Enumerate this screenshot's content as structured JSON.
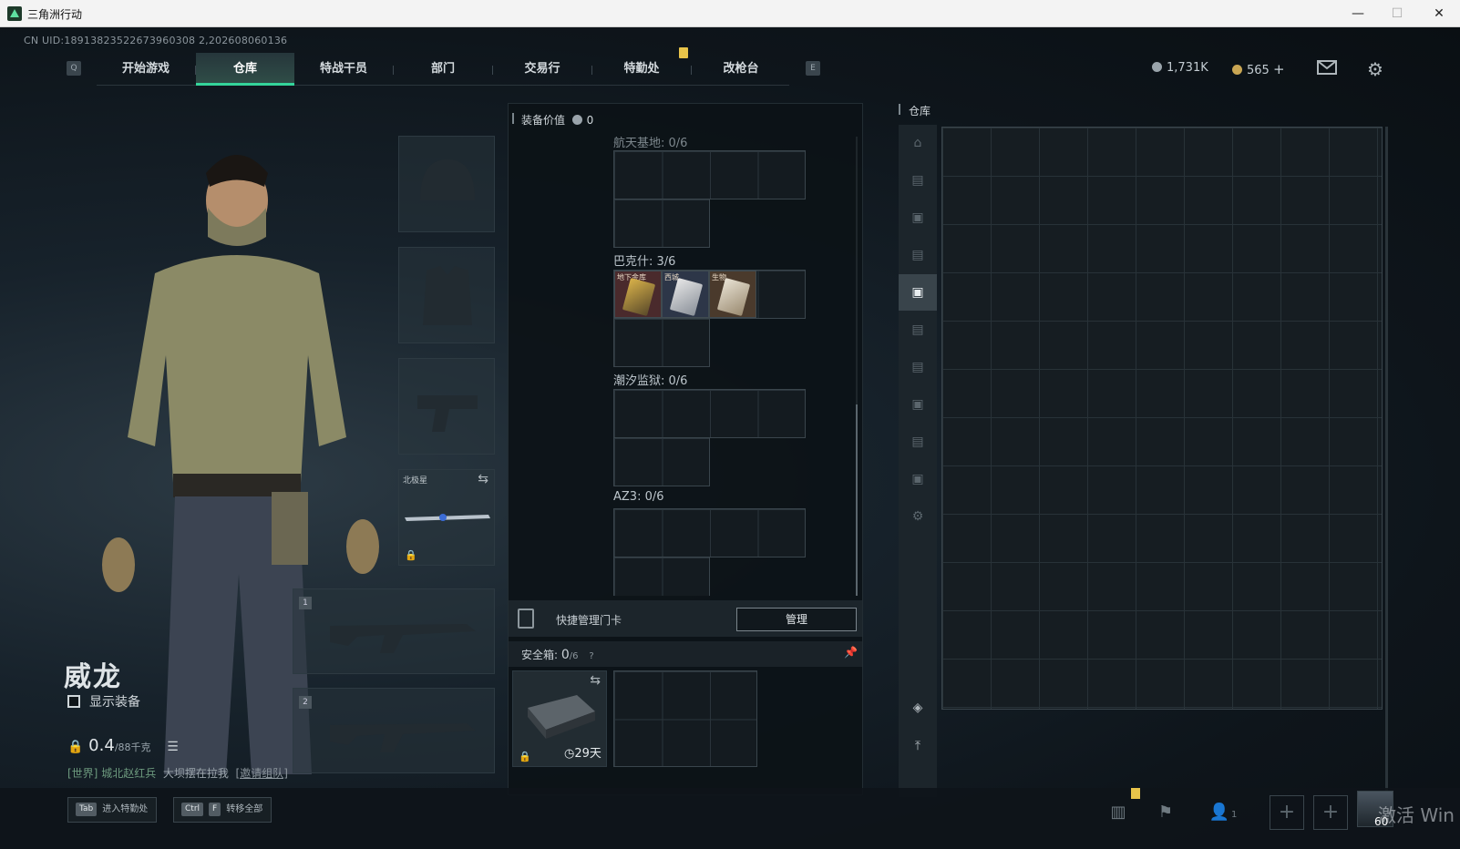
{
  "window": {
    "title": "三角洲行动",
    "minimize": "—",
    "maximize": "☐",
    "close": "✕"
  },
  "uid": "CN UID:18913823522673960308 2,202608060136",
  "nav": {
    "left_key": "Q",
    "right_key": "E",
    "tabs": [
      "开始游戏",
      "仓库",
      "特战干员",
      "部门",
      "交易行",
      "特勤处",
      "改枪台"
    ],
    "active_tab": "仓库"
  },
  "currency": {
    "silver": "1,731K",
    "gold": "565",
    "plus": "+"
  },
  "character": {
    "name": "威龙",
    "show_equipment": "显示装备",
    "weight_value": "0.4",
    "weight_unit": "/88千克"
  },
  "chat": {
    "channel": "[世界]",
    "user": "城北赵红兵",
    "message": "大坝摆在拉我",
    "invite": "[邀请组队]"
  },
  "equipment": {
    "melee_name": "北极星",
    "weapon1_num": "1",
    "weapon2_num": "2"
  },
  "middle": {
    "equip_value_label": "装备价值",
    "equip_value": "0",
    "sections": [
      {
        "label": "航天基地: 0/6"
      },
      {
        "label": "巴克什: 3/6",
        "cards": [
          "地下金库",
          "西城",
          "生物"
        ]
      },
      {
        "label": "潮汐监狱: 0/6"
      },
      {
        "label": "AZ3: 0/6"
      }
    ],
    "quick_manage": "快捷管理门卡",
    "manage_btn": "管理",
    "safebox_label": "安全箱:",
    "safebox_count": "0",
    "safebox_cap": "/6",
    "safebox_help": "?",
    "safebox_days": "29天"
  },
  "warehouse": {
    "title": "仓库"
  },
  "bottom": {
    "hint1_key": "Tab",
    "hint1_label": "进入特勤处",
    "hint2_key1": "Ctrl",
    "hint2_key2": "F",
    "hint2_label": "转移全部",
    "friends_count": "1",
    "level": "60",
    "watermark": "激活 Win"
  }
}
